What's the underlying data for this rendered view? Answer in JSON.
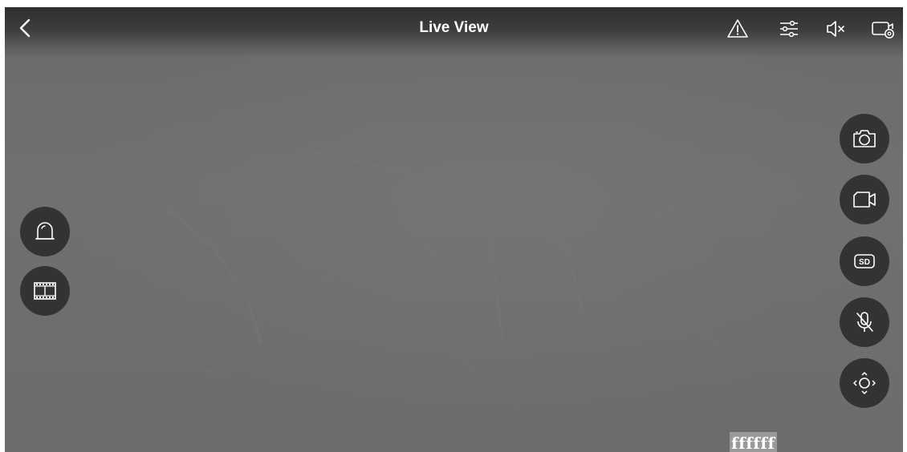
{
  "header": {
    "title": "Live View"
  },
  "icons": {
    "back": "chevron-left-icon",
    "alert": "warning-triangle-icon",
    "settings": "sliders-icon",
    "sound": "speaker-muted-icon",
    "camera_settings": "camera-settings-icon",
    "siren": "alarm-light-icon",
    "playback": "film-strip-icon",
    "snapshot": "camera-icon",
    "record": "video-camera-icon",
    "quality": "sd-quality-icon",
    "microphone": "microphone-muted-icon",
    "ptz": "ptz-direction-icon"
  },
  "quality_button": {
    "label": "SD"
  },
  "overlay": {
    "caption": "ffffff"
  },
  "colors": {
    "background": "#6d6d6d",
    "button": "#333333",
    "icon": "#ffffff"
  }
}
